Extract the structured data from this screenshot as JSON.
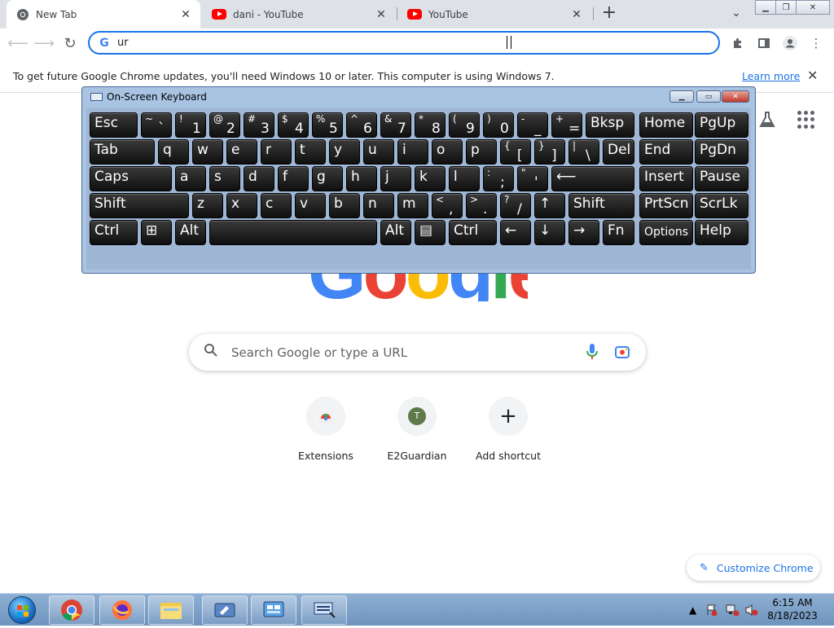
{
  "tabs": [
    {
      "title": "New Tab",
      "favicon": "chrome-icon",
      "active": true
    },
    {
      "title": "dani - YouTube",
      "favicon": "youtube-icon",
      "active": false
    },
    {
      "title": "YouTube",
      "favicon": "youtube-icon",
      "active": false
    }
  ],
  "toolbar": {
    "omnibox_text": "ur"
  },
  "infobar": {
    "message": "To get future Google Chrome updates, you'll need Windows 10 or later. This computer is using Windows 7.",
    "link": "Learn more"
  },
  "osk": {
    "title": "On-Screen Keyboard"
  },
  "ntp": {
    "search_placeholder": "Search Google or type a URL",
    "shortcuts": [
      {
        "name": "Extensions",
        "icon": "chrome-web-store-icon"
      },
      {
        "name": "E2Guardian",
        "initial": "T"
      },
      {
        "name": "Add shortcut",
        "icon": "plus-icon"
      }
    ],
    "customize_label": "Customize Chrome",
    "logo_colors": [
      "#4285f4",
      "#ea4335",
      "#fbbc05",
      "#4285f4",
      "#34a853",
      "#ea4335"
    ]
  },
  "taskbar": {
    "time": "6:15 AM",
    "date": "8/18/2023"
  },
  "keyboard_rows": [
    [
      {
        "m": "Esc"
      },
      {
        "s": "~",
        "l": "`"
      },
      {
        "s": "!",
        "l": "1"
      },
      {
        "s": "@",
        "l": "2"
      },
      {
        "s": "#",
        "l": "3"
      },
      {
        "s": "$",
        "l": "4"
      },
      {
        "s": "%",
        "l": "5"
      },
      {
        "s": "^",
        "l": "6"
      },
      {
        "s": "&",
        "l": "7"
      },
      {
        "s": "*",
        "l": "8"
      },
      {
        "s": "(",
        "l": "9"
      },
      {
        "s": ")",
        "l": "0"
      },
      {
        "s": "-",
        "l": "_"
      },
      {
        "s": "+",
        "l": "="
      },
      {
        "m": "Bksp"
      },
      {
        "m": "Home"
      },
      {
        "m": "PgUp"
      }
    ],
    [
      {
        "m": "Tab"
      },
      {
        "m": "q"
      },
      {
        "m": "w"
      },
      {
        "m": "e"
      },
      {
        "m": "r"
      },
      {
        "m": "t"
      },
      {
        "m": "y"
      },
      {
        "m": "u"
      },
      {
        "m": "i"
      },
      {
        "m": "o"
      },
      {
        "m": "p"
      },
      {
        "s": "{",
        "l": "["
      },
      {
        "s": "}",
        "l": "]"
      },
      {
        "s": "|",
        "l": "\\"
      },
      {
        "m": "Del"
      },
      {
        "m": "End"
      },
      {
        "m": "PgDn"
      }
    ],
    [
      {
        "m": "Caps"
      },
      {
        "m": "a"
      },
      {
        "m": "s"
      },
      {
        "m": "d"
      },
      {
        "m": "f"
      },
      {
        "m": "g"
      },
      {
        "m": "h"
      },
      {
        "m": "j"
      },
      {
        "m": "k"
      },
      {
        "m": "l"
      },
      {
        "s": ":",
        "l": ";"
      },
      {
        "s": "\"",
        "l": "'"
      },
      {
        "m": "⟵"
      },
      {
        "m": "Insert"
      },
      {
        "m": "Pause"
      }
    ],
    [
      {
        "m": "Shift"
      },
      {
        "m": "z"
      },
      {
        "m": "x"
      },
      {
        "m": "c"
      },
      {
        "m": "v"
      },
      {
        "m": "b"
      },
      {
        "m": "n"
      },
      {
        "m": "m"
      },
      {
        "s": "<",
        "l": ","
      },
      {
        "s": ">",
        "l": "."
      },
      {
        "s": "?",
        "l": "/"
      },
      {
        "m": "↑"
      },
      {
        "m": "Shift"
      },
      {
        "m": "PrtScn"
      },
      {
        "m": "ScrLk"
      }
    ],
    [
      {
        "m": "Ctrl"
      },
      {
        "m": "⊞"
      },
      {
        "m": "Alt"
      },
      {
        "m": ""
      },
      {
        "m": "Alt"
      },
      {
        "m": "▤"
      },
      {
        "m": "Ctrl"
      },
      {
        "m": "←"
      },
      {
        "m": "↓"
      },
      {
        "m": "→"
      },
      {
        "m": "Fn"
      },
      {
        "m": "Options"
      },
      {
        "m": "Help"
      }
    ]
  ]
}
